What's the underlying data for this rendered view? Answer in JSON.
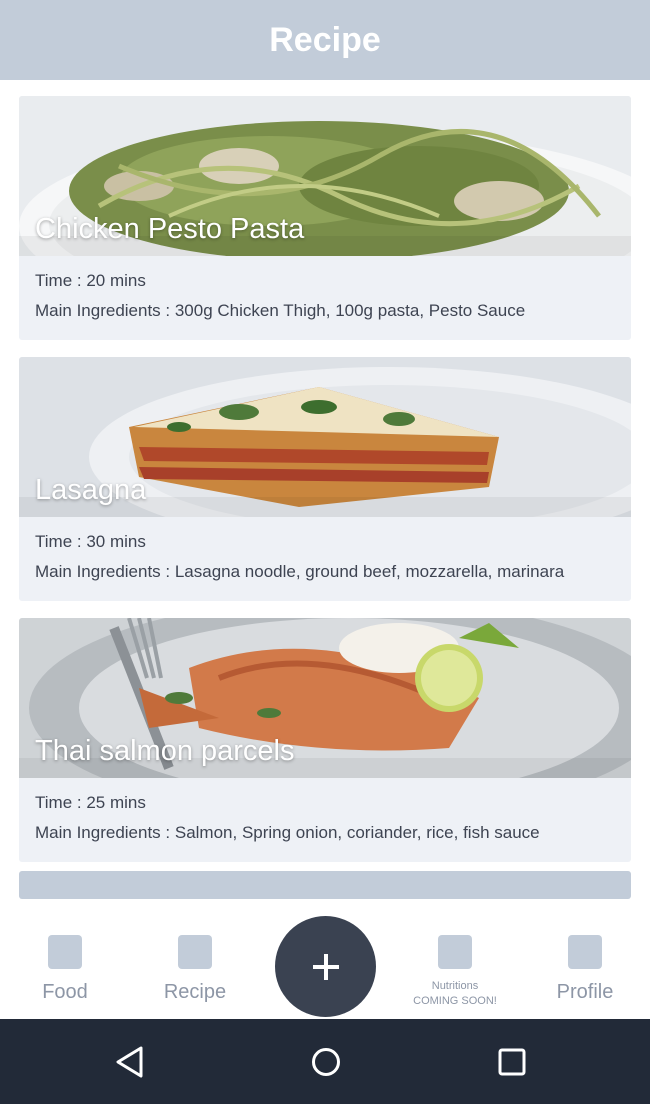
{
  "header": {
    "title": "Recipe"
  },
  "recipes": [
    {
      "title": "Chicken Pesto Pasta",
      "time": "Time : 20 mins",
      "ingredients": "Main Ingredients : 300g Chicken Thigh, 100g pasta, Pesto Sauce",
      "image_icon": "pasta-photo"
    },
    {
      "title": "Lasagna",
      "time": "Time : 30 mins",
      "ingredients": "Main Ingredients : Lasagna noodle, ground beef, mozzarella, marinara",
      "image_icon": "lasagna-photo"
    },
    {
      "title": "Thai salmon parcels",
      "time": "Time : 25 mins",
      "ingredients": "Main Ingredients : Salmon, Spring onion, coriander, rice, fish sauce",
      "image_icon": "salmon-photo"
    }
  ],
  "bottom_nav": {
    "food": "Food",
    "recipe": "Recipe",
    "add_icon": "plus-icon",
    "nutritions_line1": "Nutritions",
    "nutritions_line2": "COMING SOON!",
    "profile": "Profile"
  },
  "system_nav": {
    "back_icon": "back-triangle-icon",
    "home_icon": "home-circle-icon",
    "recents_icon": "recents-square-icon"
  },
  "colors": {
    "header_bg": "#c2ccd9",
    "card_bg": "#eef1f6",
    "fab_bg": "#3a4251",
    "system_bar_bg": "#222a38",
    "nav_label": "#8d96a6"
  }
}
